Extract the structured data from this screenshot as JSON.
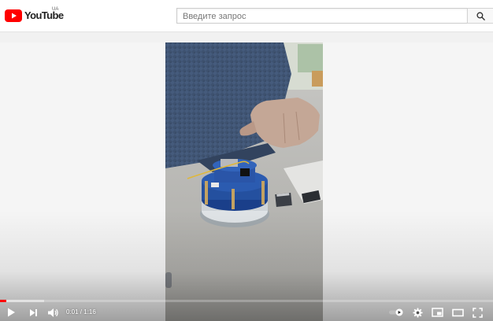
{
  "masthead": {
    "logo_text": "YouTube",
    "logo_region": "UA",
    "search": {
      "placeholder": "Введите запрос",
      "value": ""
    },
    "icons": {
      "search": "search-icon"
    }
  },
  "player": {
    "time_current": "0:01",
    "time_separator": " / ",
    "time_total": "1:16",
    "progress_played": 0.013,
    "progress_loaded": 0.09,
    "colors": {
      "progress": "#ff0000",
      "logo": "#ff0000",
      "controls": "#ffffff"
    },
    "icons": {
      "play": "play-icon",
      "next": "next-icon",
      "volume": "volume-icon",
      "autoplay": "autoplay-toggle-icon",
      "settings": "gear-icon",
      "miniplayer": "miniplayer-icon",
      "theater": "theater-mode-icon",
      "fullscreen": "fullscreen-icon"
    }
  }
}
